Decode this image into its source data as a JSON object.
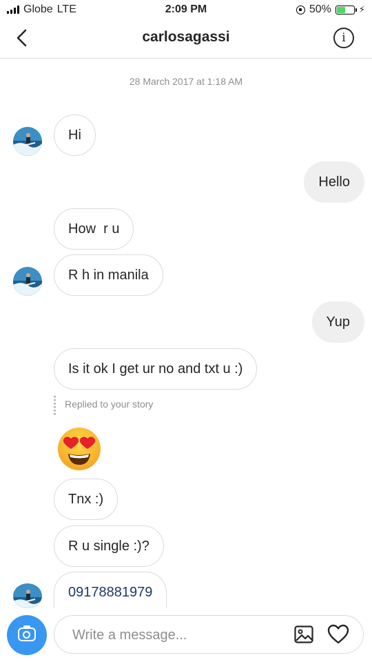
{
  "status_bar": {
    "carrier": "Globe",
    "network": "LTE",
    "time": "2:09 PM",
    "battery": "50%",
    "battery_level": 0.5
  },
  "header": {
    "title": "carlosagassi",
    "back_icon": "chevron-left-icon",
    "info_icon": "info-icon"
  },
  "conversation": {
    "date": "28 March 2017 at 1:18 AM",
    "messages": [
      {
        "from": "them",
        "text": "Hi"
      },
      {
        "from": "me",
        "text": "Hello"
      },
      {
        "from": "them",
        "text": "How  r u"
      },
      {
        "from": "them",
        "text": "R h in manila"
      },
      {
        "from": "me",
        "text": "Yup"
      },
      {
        "from": "them",
        "text": "Is it ok I get ur no and txt u :)"
      },
      {
        "from": "them",
        "type": "emoji",
        "emoji": "heart-eyes"
      },
      {
        "from": "them",
        "text": "Tnx :)"
      },
      {
        "from": "them",
        "text": "R u single :)?"
      },
      {
        "from": "them",
        "text": "09178881979",
        "type": "phone-link"
      }
    ],
    "story_reply": "Replied to your story"
  },
  "composer": {
    "placeholder": "Write a message...",
    "camera_icon": "camera-icon",
    "gallery_icon": "gallery-icon",
    "heart_icon": "heart-icon"
  },
  "colors": {
    "camera_button": "#3897f0",
    "incoming_border": "#dbdbdb",
    "outgoing_bg": "#efefef",
    "meta_text": "#8e8e8e",
    "phone_link": "#1d3a6b"
  }
}
